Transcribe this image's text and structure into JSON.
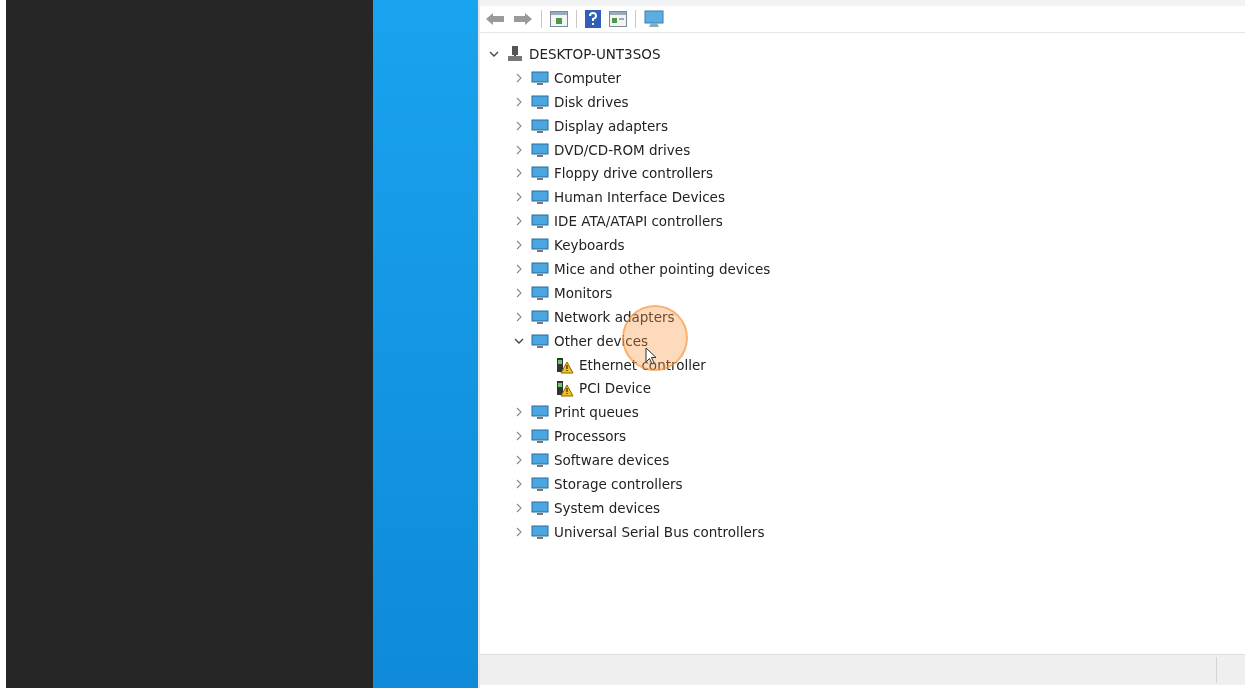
{
  "tree": [
    {
      "label": "DESKTOP-UNT3SOS",
      "expanded": true,
      "warning": false,
      "children": [
        {
          "label": "Computer",
          "expanded": false,
          "warning": false
        },
        {
          "label": "Disk drives",
          "expanded": false,
          "warning": false
        },
        {
          "label": "Display adapters",
          "expanded": false,
          "warning": false
        },
        {
          "label": "DVD/CD-ROM drives",
          "expanded": false,
          "warning": false
        },
        {
          "label": "Floppy drive controllers",
          "expanded": false,
          "warning": false
        },
        {
          "label": "Human Interface Devices",
          "expanded": false,
          "warning": false
        },
        {
          "label": "IDE ATA/ATAPI controllers",
          "expanded": false,
          "warning": false
        },
        {
          "label": "Keyboards",
          "expanded": false,
          "warning": false
        },
        {
          "label": "Mice and other pointing devices",
          "expanded": false,
          "warning": false
        },
        {
          "label": "Monitors",
          "expanded": false,
          "warning": false
        },
        {
          "label": "Network adapters",
          "expanded": false,
          "warning": false
        },
        {
          "label": "Other devices",
          "expanded": true,
          "warning": false,
          "children": [
            {
              "label": "Ethernet controller",
              "warning": true
            },
            {
              "label": "PCI Device",
              "warning": true
            }
          ]
        },
        {
          "label": "Print queues",
          "expanded": false,
          "warning": false
        },
        {
          "label": "Processors",
          "expanded": false,
          "warning": false
        },
        {
          "label": "Software devices",
          "expanded": false,
          "warning": false
        },
        {
          "label": "Storage controllers",
          "expanded": false,
          "warning": false
        },
        {
          "label": "System devices",
          "expanded": false,
          "warning": false
        },
        {
          "label": "Universal Serial Bus controllers",
          "expanded": false,
          "warning": false
        }
      ]
    }
  ]
}
